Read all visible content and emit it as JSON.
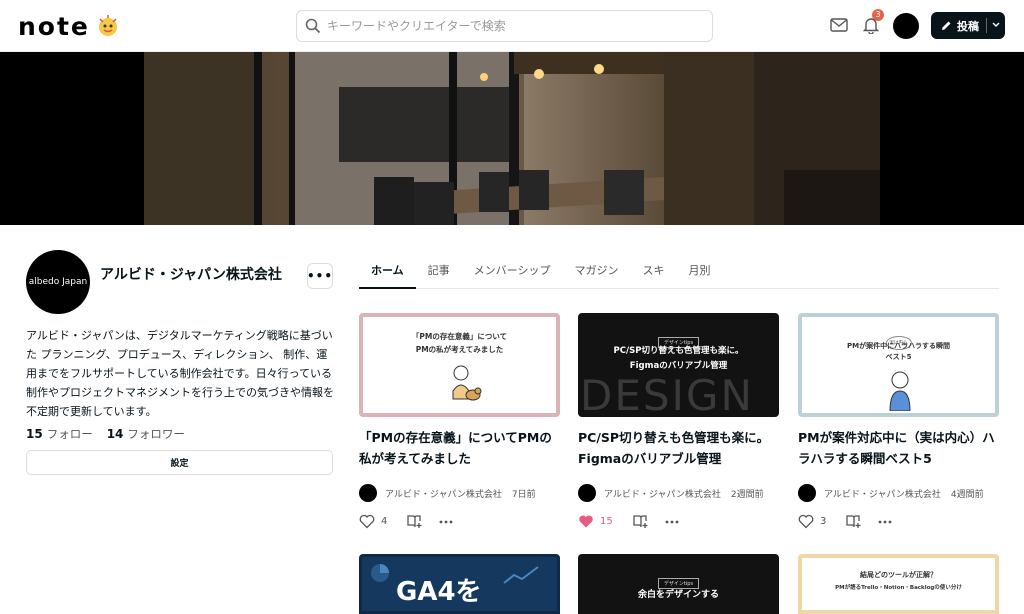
{
  "header": {
    "logo": "note",
    "search_placeholder": "キーワードやクリエイターで検索",
    "notification_count": "3",
    "post_label": "投稿"
  },
  "profile": {
    "avatar_text": "albedo Japan",
    "name": "アルビド・ジャパン株式会社",
    "more": "•••",
    "bio": "アルビド・ジャパンは、デジタルマーケティング戦略に基づいた プランニング、プロデュース、ディレクション、 制作、運用までをフルサポートしている制作会社です。日々行っている制作やプロジェクトマネジメントを行う上での気づきや情報を不定期で更新しています。",
    "follow_count": "15",
    "follow_label": "フォロー",
    "follower_count": "14",
    "follower_label": "フォロワー",
    "settings_label": "設定"
  },
  "tabs": [
    "ホーム",
    "記事",
    "メンバーシップ",
    "マガジン",
    "スキ",
    "月別"
  ],
  "articles": [
    {
      "thumb_line1": "「PMの存在意義」について",
      "thumb_line2": "PMの私が考えてみました",
      "title": "「PMの存在意義」についてPMの私が考えてみました",
      "author": "アルビド・ジャパン株式会社",
      "date": "7日前",
      "likes": "4",
      "liked": false
    },
    {
      "thumb_tag": "デザインtips",
      "thumb_line1": "PC/SP切り替えも色管理も楽に。",
      "thumb_line2": "Figmaのバリアブル管理",
      "thumb_big": "DESIGN",
      "title": "PC/SP切り替えも色管理も楽に。Figmaのバリアブル管理",
      "author": "アルビド・ジャパン株式会社",
      "date": "2週間前",
      "likes": "15",
      "liked": true
    },
    {
      "thumb_tag": "実は内心",
      "thumb_line1": "PMが案件中にハラハラする瞬間",
      "thumb_line2": "ベスト5",
      "title": "PMが案件対応中に（実は内心）ハラハラする瞬間ベスト5",
      "author": "アルビド・ジャパン株式会社",
      "date": "4週間前",
      "likes": "3",
      "liked": false
    }
  ],
  "more_articles": [
    {
      "thumb_text": "GA4を"
    },
    {
      "thumb_tag": "デザインtips",
      "thumb_text": "余白をデザインする"
    },
    {
      "thumb_line1": "結局どのツールが正解？",
      "thumb_line2": "PMが語るTrello・Notion・Backlogの使い分け"
    }
  ],
  "colors": {
    "brand_dark": "#08131a",
    "like_pink": "#e65d84",
    "badge": "#e6644b"
  }
}
